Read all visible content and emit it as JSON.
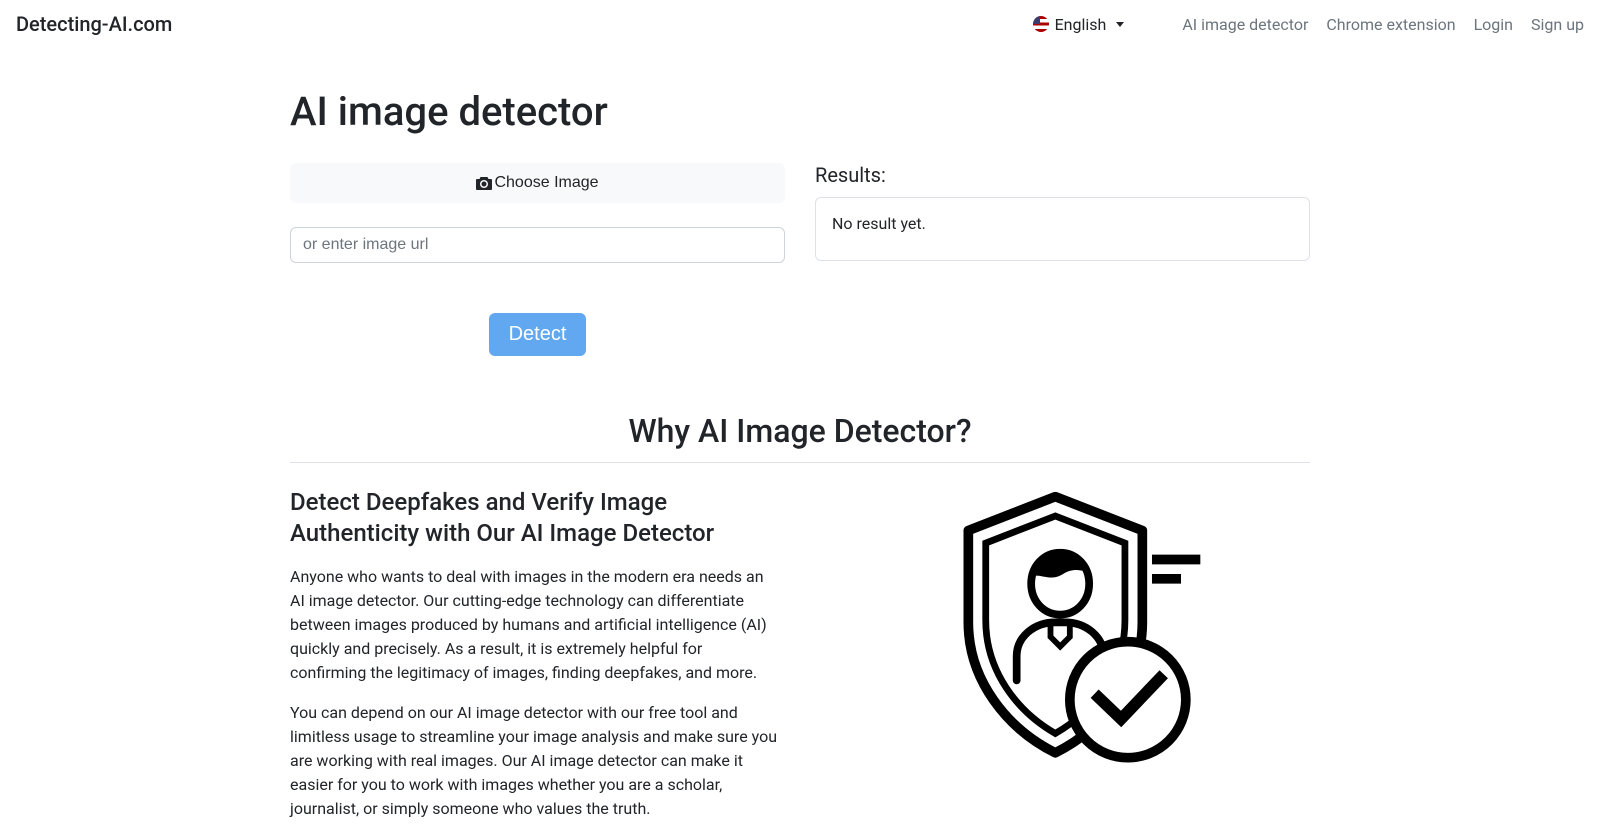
{
  "navbar": {
    "brand": "Detecting-AI.com",
    "language": "English",
    "links": {
      "detector": "AI image detector",
      "extension": "Chrome extension",
      "login": "Login",
      "signup": "Sign up"
    }
  },
  "page": {
    "title": "AI image detector",
    "choose_image_label": "Choose Image",
    "url_placeholder": "or enter image url",
    "detect_button": "Detect",
    "results_label": "Results:",
    "results_text": "No result yet."
  },
  "why_section": {
    "title": "Why AI Image Detector?",
    "heading": "Detect Deepfakes and Verify Image Authenticity with Our AI Image Detector",
    "paragraph1": "Anyone who wants to deal with images in the modern era needs an AI image detector. Our cutting-edge technology can differentiate between images produced by humans and artificial intelligence (AI) quickly and precisely. As a result, it is extremely helpful for confirming the legitimacy of images, finding deepfakes, and more.",
    "paragraph2": "You can depend on our AI image detector with our free tool and limitless usage to streamline your image analysis and make sure you are working with real images. Our AI image detector can make it easier for you to work with images whether you are a scholar, journalist, or simply someone who values the truth."
  }
}
